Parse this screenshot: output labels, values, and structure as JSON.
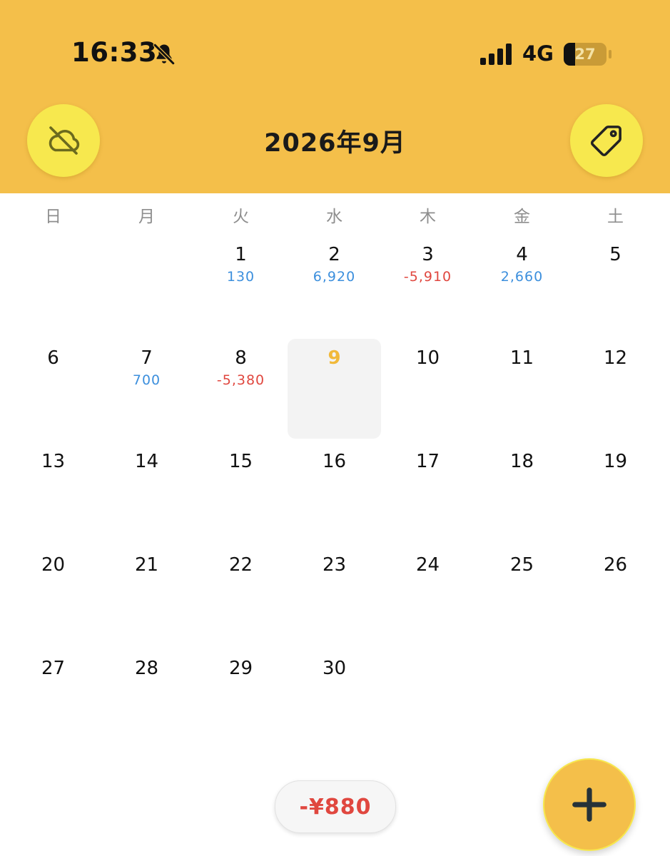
{
  "status_bar": {
    "time": "16:33",
    "network": "4G",
    "battery_level": 27,
    "battery_label": "27",
    "bell_icon": "bell-slash-icon",
    "signal_icon": "cellular-signal-icon"
  },
  "header": {
    "title": "2026年9月",
    "left_icon": "cloud-off-icon",
    "right_icon": "tag-icon"
  },
  "weekdays": [
    "日",
    "月",
    "火",
    "水",
    "木",
    "金",
    "土"
  ],
  "calendar": {
    "first_weekday_index": 2,
    "today": 9,
    "days": [
      {
        "day": "1",
        "amount": "130",
        "sign": "pos"
      },
      {
        "day": "2",
        "amount": "6,920",
        "sign": "pos"
      },
      {
        "day": "3",
        "amount": "-5,910",
        "sign": "neg"
      },
      {
        "day": "4",
        "amount": "2,660",
        "sign": "pos"
      },
      {
        "day": "5"
      },
      {
        "day": "6"
      },
      {
        "day": "7",
        "amount": "700",
        "sign": "pos"
      },
      {
        "day": "8",
        "amount": "-5,380",
        "sign": "neg"
      },
      {
        "day": "9"
      },
      {
        "day": "10"
      },
      {
        "day": "11"
      },
      {
        "day": "12"
      },
      {
        "day": "13"
      },
      {
        "day": "14"
      },
      {
        "day": "15"
      },
      {
        "day": "16"
      },
      {
        "day": "17"
      },
      {
        "day": "18"
      },
      {
        "day": "19"
      },
      {
        "day": "20"
      },
      {
        "day": "21"
      },
      {
        "day": "22"
      },
      {
        "day": "23"
      },
      {
        "day": "24"
      },
      {
        "day": "25"
      },
      {
        "day": "26"
      },
      {
        "day": "27"
      },
      {
        "day": "28"
      },
      {
        "day": "29"
      },
      {
        "day": "30"
      }
    ]
  },
  "colors": {
    "header_bg": "#F4BF4A",
    "button_bg": "#F7E84E",
    "positive": "#3C8FDD",
    "negative": "#E0473F",
    "today": "#F1B93A"
  },
  "footer": {
    "total": "-¥880",
    "add_icon": "plus-icon"
  }
}
